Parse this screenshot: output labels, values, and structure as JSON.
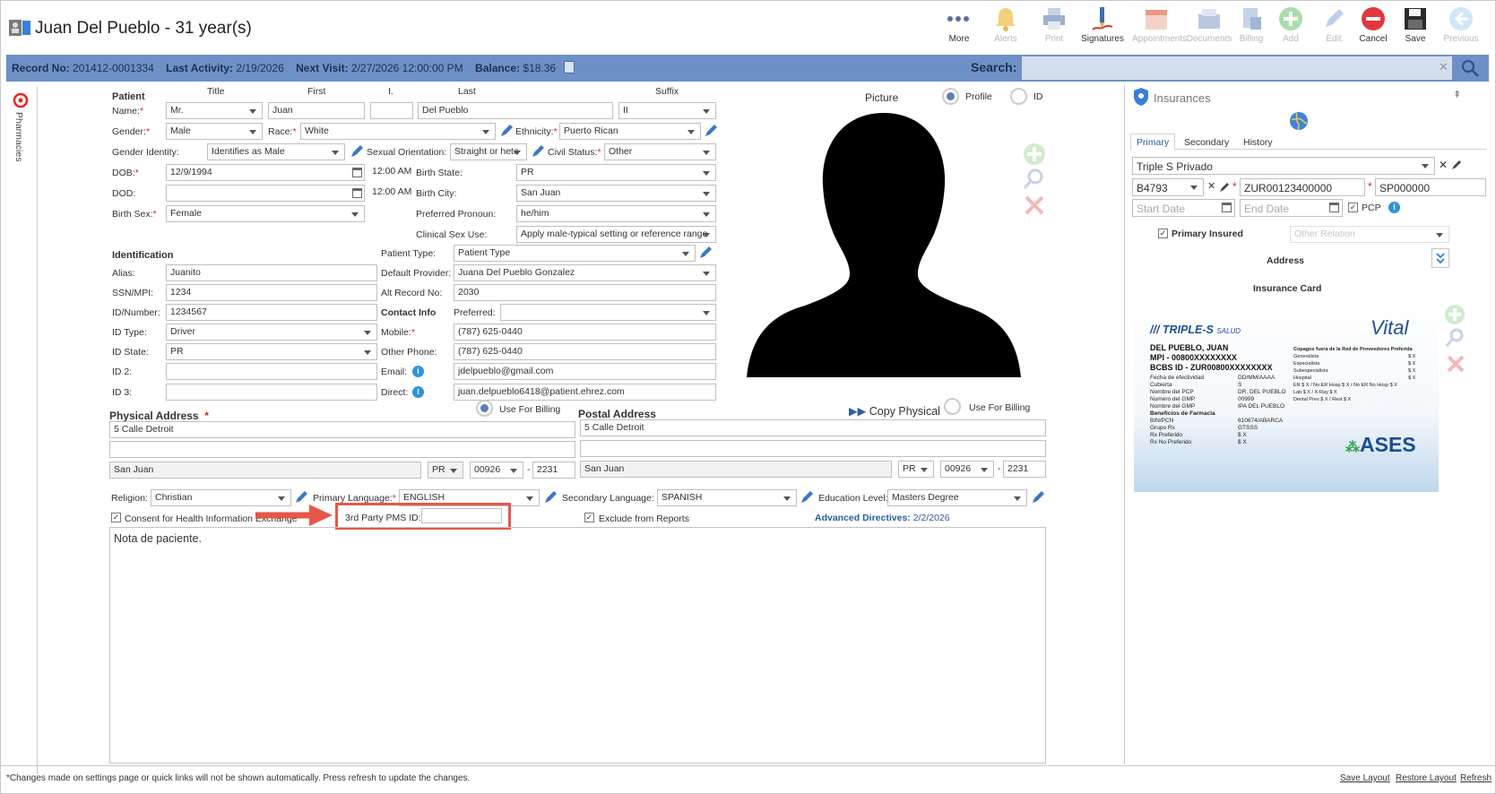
{
  "window": {
    "title": "Juan Del Pueblo - 31 year(s)"
  },
  "toolbar": {
    "more": "More",
    "alerts": "Alerts",
    "print": "Print",
    "signatures": "Signatures",
    "appointments": "Appointments",
    "documents": "Documents",
    "billing": "Billing",
    "add": "Add",
    "edit": "Edit",
    "cancel": "Cancel",
    "save": "Save",
    "previous": "Previous"
  },
  "infobar": {
    "record_label": "Record No:",
    "record_value": "201412-0001334",
    "activity_label": "Last Activity:",
    "activity_value": "2/19/2026",
    "visit_label": "Next Visit:",
    "visit_value": "2/27/2026 12:00:00 PM",
    "balance_label": "Balance:",
    "balance_value": "$18.36",
    "search_label": "Search:",
    "search_value": ""
  },
  "sidebar": {
    "pharmacies": "Pharmacies"
  },
  "patient": {
    "section": "Patient",
    "col_title": "Title",
    "col_first": "First",
    "col_initial": "I.",
    "col_last": "Last",
    "col_suffix": "Suffix",
    "name_label": "Name:",
    "title": "Mr.",
    "first": "Juan",
    "initial": "",
    "last": "Del Pueblo",
    "suffix": "II",
    "gender_label": "Gender:",
    "gender": "Male",
    "race_label": "Race:",
    "race": "White",
    "ethnicity_label": "Ethnicity:",
    "ethnicity": "Puerto Rican",
    "gender_identity_label": "Gender Identity:",
    "gender_identity": "Identifies as Male",
    "orientation_label": "Sexual Orientation:",
    "orientation": "Straight or hete",
    "civil_label": "Civil Status:",
    "civil": "Other",
    "dob_label": "DOB:",
    "dob": "12/9/1994",
    "dob_time": "12:00 AM",
    "birth_state_label": "Birth State:",
    "birth_state": "PR",
    "dod_label": "DOD:",
    "dod": "",
    "dod_time": "12:00 AM",
    "birth_city_label": "Birth City:",
    "birth_city": "San Juan",
    "birth_sex_label": "Birth Sex:",
    "birth_sex": "Female",
    "pronoun_label": "Preferred Pronoun:",
    "pronoun": "he/him",
    "clinical_label": "Clinical Sex Use:",
    "clinical": "Apply male-typical setting or reference range"
  },
  "identification": {
    "section": "Identification",
    "alias_label": "Alias:",
    "alias": "Juanito",
    "ssn_label": "SSN/MPI:",
    "ssn": "1234",
    "idnum_label": "ID/Number:",
    "idnum": "1234567",
    "idtype_label": "ID Type:",
    "idtype": "Driver",
    "idstate_label": "ID State:",
    "idstate": "PR",
    "id2_label": "ID 2:",
    "id2": "",
    "id3_label": "ID 3:",
    "id3": "",
    "ptype_label": "Patient Type:",
    "ptype": "Patient Type",
    "provider_label": "Default Provider:",
    "provider": "Juana Del Pueblo Gonzalez",
    "alt_label": "Alt Record No:",
    "alt": "2030"
  },
  "contact": {
    "section": "Contact Info",
    "preferred_label": "Preferred:",
    "preferred": "",
    "mobile_label": "Mobile:",
    "mobile": "(787) 625-0440",
    "other_label": "Other Phone:",
    "other": "(787) 625-0440",
    "email_label": "Email:",
    "email": "jdelpueblo@gmail.com",
    "direct_label": "Direct:",
    "direct": "juan.delpueblo6418@patient.ehrez.com"
  },
  "picture": {
    "label": "Picture",
    "profile": "Profile",
    "id": "ID"
  },
  "physical": {
    "section": "Physical Address",
    "billing": "Use For Billing",
    "line1": "5 Calle Detroit",
    "line2": "",
    "city": "San Juan",
    "state": "PR",
    "zip": "00926",
    "zip4": "2231"
  },
  "postal": {
    "section": "Postal Address",
    "copy": "Copy Physical",
    "billing": "Use For Billing",
    "line1": "5 Calle Detroit",
    "line2": "",
    "city": "San Juan",
    "state": "PR",
    "zip": "00926",
    "zip4": "2231"
  },
  "misc": {
    "religion_label": "Religion:",
    "religion": "Christian",
    "primary_lang_label": "Primary Language:",
    "primary_lang": "ENGLISH",
    "secondary_lang_label": "Secondary Language:",
    "secondary_lang": "SPANISH",
    "education_label": "Education Level:",
    "education": "Masters Degree",
    "consent": "Consent for Health Information Exchange",
    "pms_label": "3rd Party PMS ID:",
    "pms": "",
    "exclude": "Exclude from Reports",
    "advanced_label": "Advanced Directives:",
    "advanced_date": "2/2/2026"
  },
  "notes": {
    "text": "Nota de paciente."
  },
  "insurances": {
    "title": "Insurances",
    "tab_primary": "Primary",
    "tab_secondary": "Secondary",
    "tab_history": "History",
    "plan": "Triple S Privado",
    "group": "B4793",
    "member": "ZUR00123400000",
    "sp": "SP000000",
    "start_placeholder": "Start Date",
    "end_placeholder": "End Date",
    "pcp": "PCP",
    "primary_insured": "Primary Insured",
    "other_relation": "Other Relation",
    "address": "Address",
    "card": "Insurance Card"
  },
  "card": {
    "brand": "TRIPLE-S",
    "brand_sub": "SALUD",
    "vital": "Vital",
    "name": "DEL PUEBLO, JUAN",
    "mpi": "MPI - 00800XXXXXXXX",
    "bcbs": "BCBS ID - ZUR00800XXXXXXXX",
    "ases": "ASES",
    "f1": "Fecha de efectividad",
    "v1": "DD/MM/AAAA",
    "f2": "Cubierta",
    "v2": "S",
    "f3": "Nombre del PCP",
    "v3": "DR. DEL PUEBLO",
    "f4": "Numero del GMP",
    "v4": "00999",
    "f5": "Nombre del GMP",
    "v5": "IPA DEL PUEBLO",
    "f6": "Beneficios de Farmacia",
    "f7": "BIN/PCN",
    "v7": "610674/ABARCA",
    "f8": "Grupo Rx",
    "v8": "GTSSS",
    "f9": "Rx Preferido",
    "v9": "$ X",
    "f10": "Rx No Preferido",
    "v10": "$ X",
    "r0": "Copagos fuera de la Red de Proveedores Preferida",
    "r1": "Generalista",
    "r2": "Especialista",
    "r3": "Subespecialista",
    "r4": "Hospital",
    "r5": "ER $ X / No ER Hosp $ X / No ER No Hosp $ X",
    "r6": "Lab $ X / X-Ray $ X",
    "r7": "Dental Prev $ X / Rest $ X",
    "rv": "$ X"
  },
  "footer": {
    "note": "*Changes made on settings page or quick links will not be shown automatically. Press refresh to update the changes.",
    "save_layout": "Save Layout",
    "restore_layout": "Restore Layout",
    "refresh": "Refresh"
  }
}
